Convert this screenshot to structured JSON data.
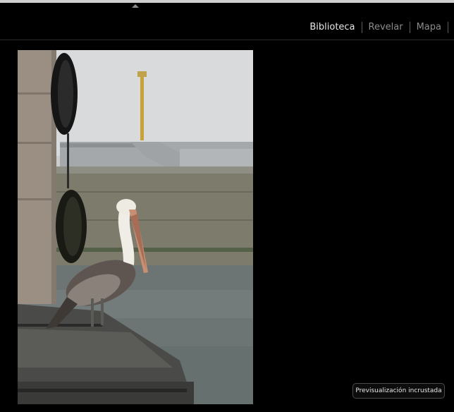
{
  "modules": {
    "items": [
      {
        "label": "Biblioteca",
        "active": true
      },
      {
        "label": "Revelar",
        "active": false
      },
      {
        "label": "Mapa",
        "active": false
      }
    ]
  },
  "panel_toggle": {
    "icon": "triangle-up-icon"
  },
  "preview": {
    "subject": "pelican on pier",
    "badge_label": "Previsualización incrustada"
  },
  "colors": {
    "background": "#000000",
    "active_module": "#e6e6e6",
    "inactive_module": "#8c8c8c"
  }
}
